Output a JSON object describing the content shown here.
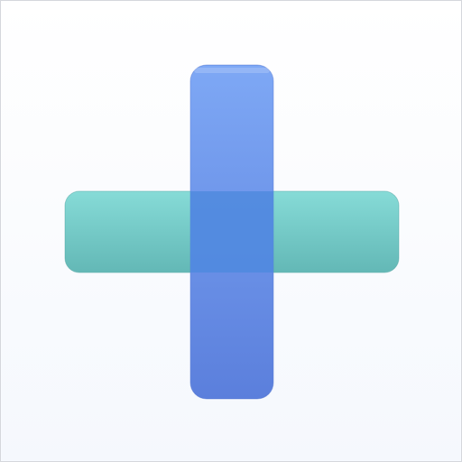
{
  "icon": {
    "name": "plus-icon",
    "colors": {
      "background_top": "#ffffff",
      "background_bottom": "#f5f8fd",
      "border": "#d7d9de",
      "vertical_bar_top": "#7ea8f5",
      "vertical_bar_bottom": "#5b7fdc",
      "horizontal_bar_top": "#86dbd7",
      "horizontal_bar_bottom": "#63b8b6",
      "overlap": "#4f89de"
    }
  }
}
